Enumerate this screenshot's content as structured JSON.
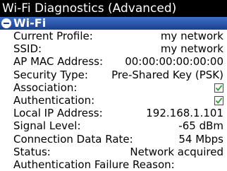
{
  "window": {
    "title": "Wi-Fi Diagnostics (Advanced)"
  },
  "section": {
    "title": "Wi-Fi",
    "expanded": true
  },
  "fields": [
    {
      "label": "Current Profile:",
      "value": "my network"
    },
    {
      "label": "SSID:",
      "value": "my network"
    },
    {
      "label": "AP MAC Address:",
      "value": "00:00:00:00:00:00"
    },
    {
      "label": "Security Type:",
      "value": "Pre-Shared Key (PSK)"
    },
    {
      "label": "Association:",
      "checked": true
    },
    {
      "label": "Authentication:",
      "checked": true
    },
    {
      "label": "Local IP Address:",
      "value": "192.168.1.101"
    },
    {
      "label": "Signal Level:",
      "value": "-65 dBm"
    },
    {
      "label": "Connection Data Rate:",
      "value": "54 Mbps"
    },
    {
      "label": "Status:",
      "value": "Network acquired"
    },
    {
      "label": "Authentication Failure Reason:",
      "value": ""
    }
  ],
  "colors": {
    "titlebar_bg": "#000000",
    "section_bg": "#2a52a8",
    "check_color": "#2e9e2e"
  }
}
